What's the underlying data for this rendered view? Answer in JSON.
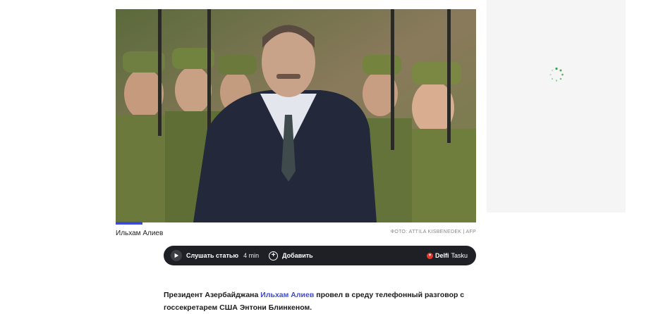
{
  "hero": {
    "caption": "Ильхам Алиев",
    "credit": "ФОТО: ATTILA KISBENEDEK | AFP"
  },
  "player": {
    "listen_label": "Слушать статью",
    "duration": "4 min",
    "add_label": "Добавить",
    "brand_main": "Delfi",
    "brand_sub": "Tasku"
  },
  "article": {
    "lead_prefix": "Президент Азербайджана ",
    "lead_link": "Ильхам Алиев",
    "lead_suffix": " провел в среду телефонный разговор с госсекретарем США Энтони Блинкеном."
  },
  "colors": {
    "accent": "#3e4bd6",
    "player_bg": "#1e2025",
    "brand_red": "#e8372c",
    "spinner": "#3aa04a"
  },
  "icons": {
    "play": "play-icon",
    "add": "plus-circle-icon",
    "brand": "delfi-logo-icon",
    "loading": "loading-spinner-icon"
  }
}
